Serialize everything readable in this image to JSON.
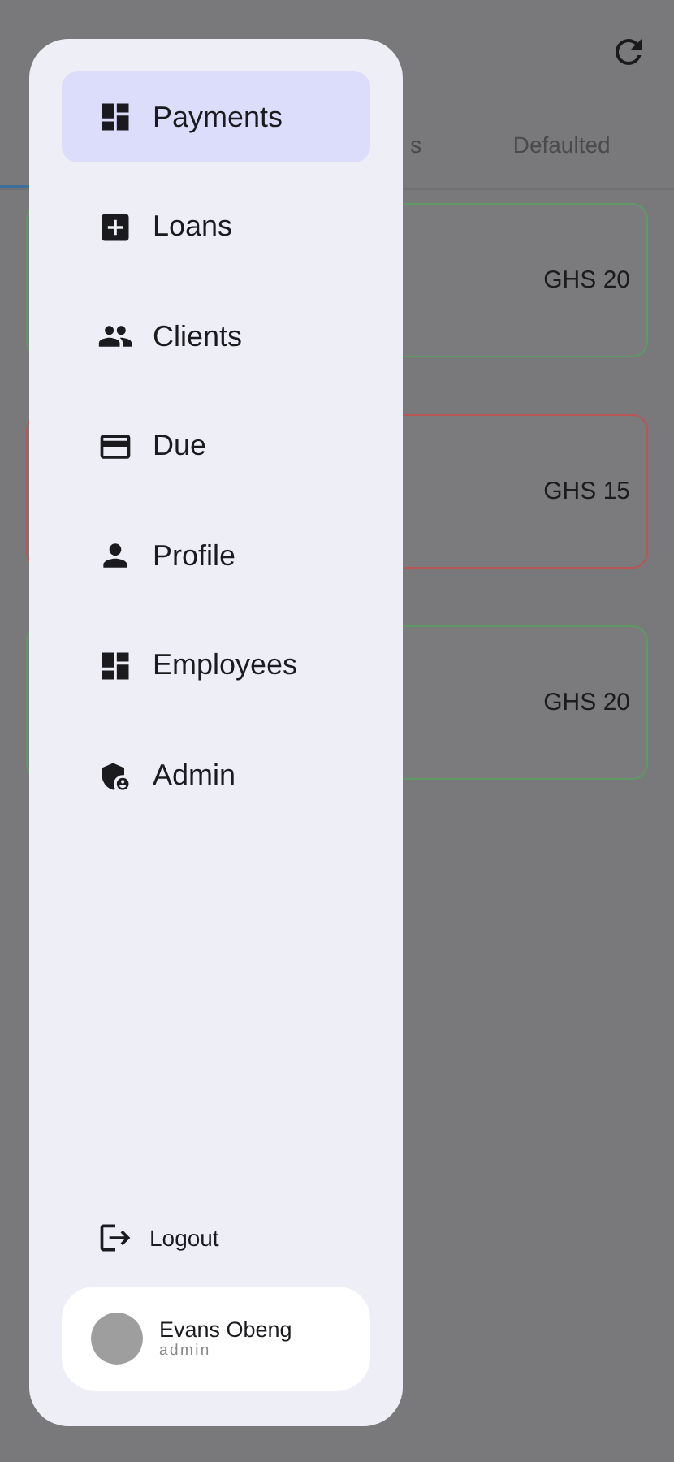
{
  "tabs": [
    {
      "selected": true
    },
    {
      "label": "s",
      "selected": false
    },
    {
      "label": "Defaulted",
      "selected": false
    }
  ],
  "cards": [
    {
      "amount": "GHS 20",
      "color": "#5f9a66"
    },
    {
      "amount": "GHS 15",
      "color": "#b85555"
    },
    {
      "amount": "GHS 20",
      "color": "#5f9a66"
    }
  ],
  "drawer": {
    "items": [
      {
        "label": "Payments",
        "selected": true
      },
      {
        "label": "Loans",
        "selected": false
      },
      {
        "label": "Clients",
        "selected": false
      },
      {
        "label": "Due",
        "selected": false
      },
      {
        "label": "Profile",
        "selected": false
      },
      {
        "label": "Employees",
        "selected": false
      },
      {
        "label": "Admin",
        "selected": false
      }
    ],
    "logout": "Logout",
    "user": {
      "name": "Evans Obeng",
      "role": "admin"
    }
  }
}
